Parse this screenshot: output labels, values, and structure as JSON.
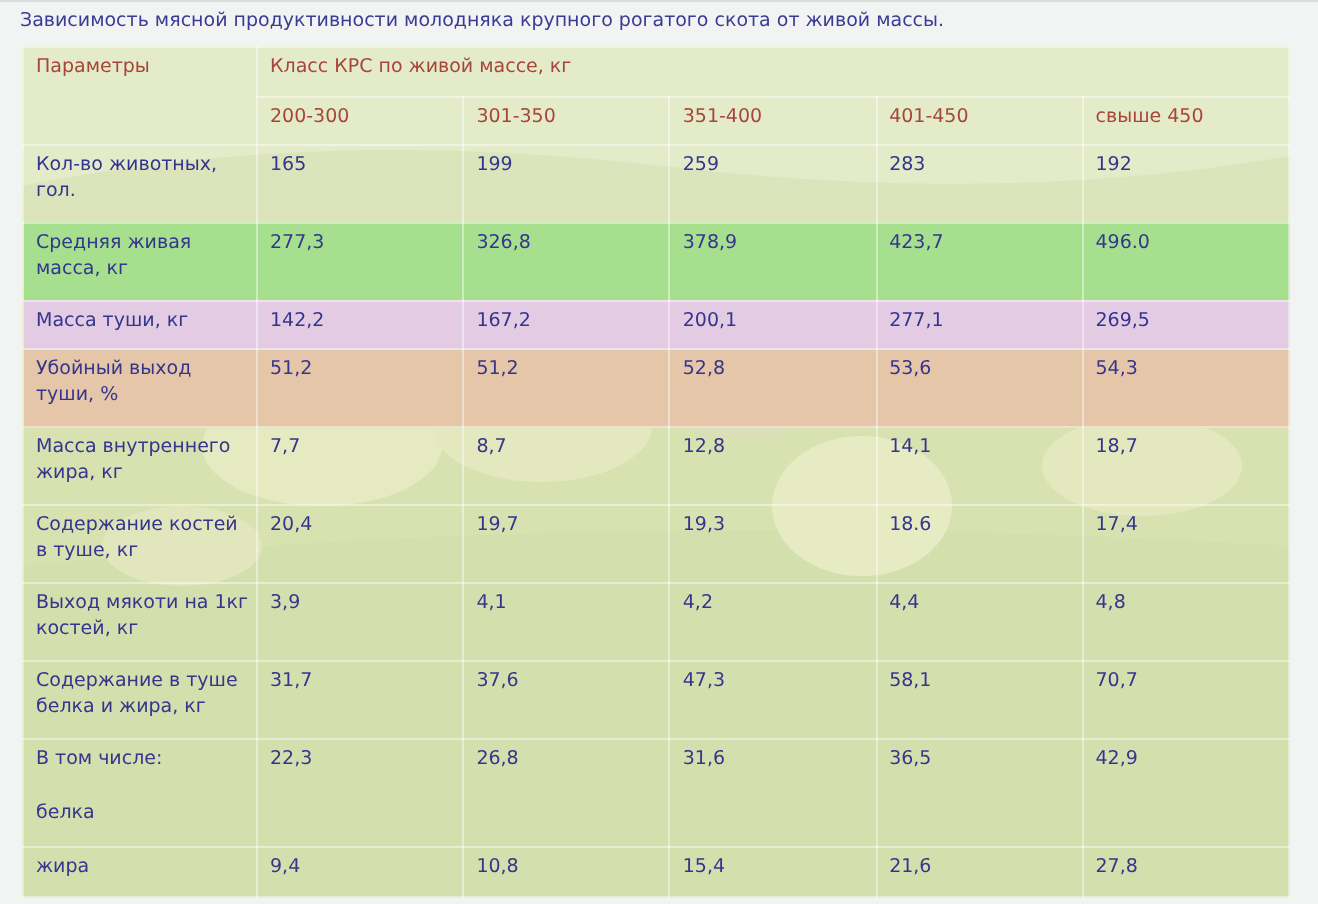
{
  "caption": "Зависимость мясной продуктивности молодняка крупного рогатого скота от живой массы.",
  "table": {
    "param_header": "Параметры",
    "group_header": "Класс КРС по живой массе,  кг",
    "columns": [
      "200-300",
      "301-350",
      "351-400",
      "401-450",
      "свыше 450"
    ],
    "rows": [
      {
        "label": "Кол-во животных, гол.",
        "values": [
          "165",
          "199",
          "259",
          "283",
          "192"
        ]
      },
      {
        "label": "Средняя живая масса, кг",
        "color": "#a6e08e",
        "values": [
          "277,3",
          "326,8",
          "378,9",
          "423,7",
          "496.0"
        ]
      },
      {
        "label": "Масса туши, кг",
        "color": "#e2cbe3",
        "values": [
          "142,2",
          "167,2",
          "200,1",
          "277,1",
          "269,5"
        ]
      },
      {
        "label": "Убойный выход туши, %",
        "color": "#e6c6a8",
        "values": [
          "51,2",
          "51,2",
          "52,8",
          "53,6",
          "54,3"
        ]
      },
      {
        "label": "Масса внутреннего жира, кг",
        "values": [
          "7,7",
          "8,7",
          "12,8",
          "14,1",
          "18,7"
        ]
      },
      {
        "label": "Содержание костей в туше, кг",
        "values": [
          "20,4",
          "19,7",
          "19,3",
          "18.6",
          "17,4"
        ]
      },
      {
        "label": "Выход мякоти на 1кг костей, кг",
        "values": [
          "3,9",
          "4,1",
          "4,2",
          "4,4",
          "4,8"
        ]
      },
      {
        "label": "Содержание в туше белка и жира, кг",
        "values": [
          "31,7",
          "37,6",
          "47,3",
          "58,1",
          "70,7"
        ]
      },
      {
        "label": "В том числе:",
        "sublabel": "белка",
        "values": [
          "22,3",
          "26,8",
          "31,6",
          "36,5",
          "42,9"
        ]
      },
      {
        "label": "жира",
        "values": [
          "9,4",
          "10,8",
          "15,4",
          "21,6",
          "27,8"
        ]
      }
    ]
  }
}
